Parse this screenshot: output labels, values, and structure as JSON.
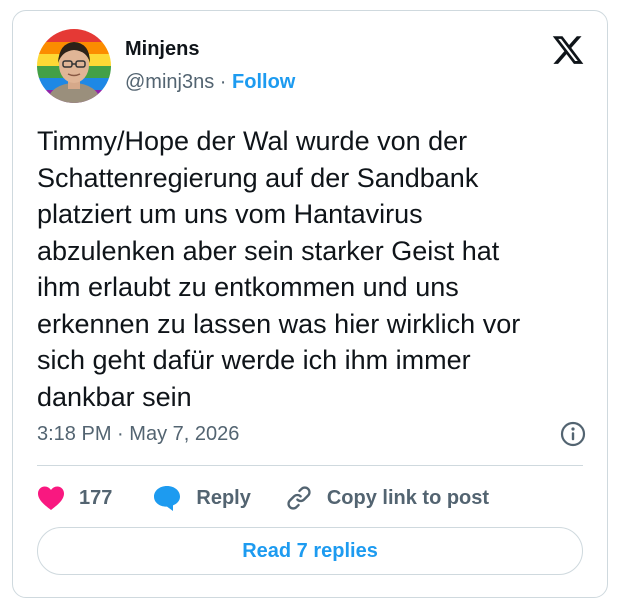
{
  "author": {
    "name": "Minjens",
    "handle": "@minj3ns",
    "separator": "·",
    "follow_label": "Follow"
  },
  "tweet": {
    "text": "Timmy/Hope der Wal wurde von der\nSchattenregierung auf der Sandbank\nplatziert um uns vom Hantavirus\nabzulenken aber sein starker Geist hat\nihm erlaubt zu entkommen und uns\nerkennen zu lassen was hier wirklich vor\nsich geht dafür werde ich ihm immer\ndankbar sein",
    "time": "3:18 PM",
    "separator": "·",
    "date": "May 7, 2026"
  },
  "actions": {
    "like_count": "177",
    "reply_label": "Reply",
    "copy_link_label": "Copy link to post"
  },
  "read_replies_label": "Read 7 replies",
  "icons": {
    "brand": "x-logo-icon",
    "info": "info-icon",
    "like": "heart-icon",
    "reply": "speech-bubble-icon",
    "copy": "link-icon"
  },
  "colors": {
    "accent": "#1d9bf0",
    "heart": "#f91880",
    "muted_text": "#536471",
    "border": "#cfd9de"
  }
}
